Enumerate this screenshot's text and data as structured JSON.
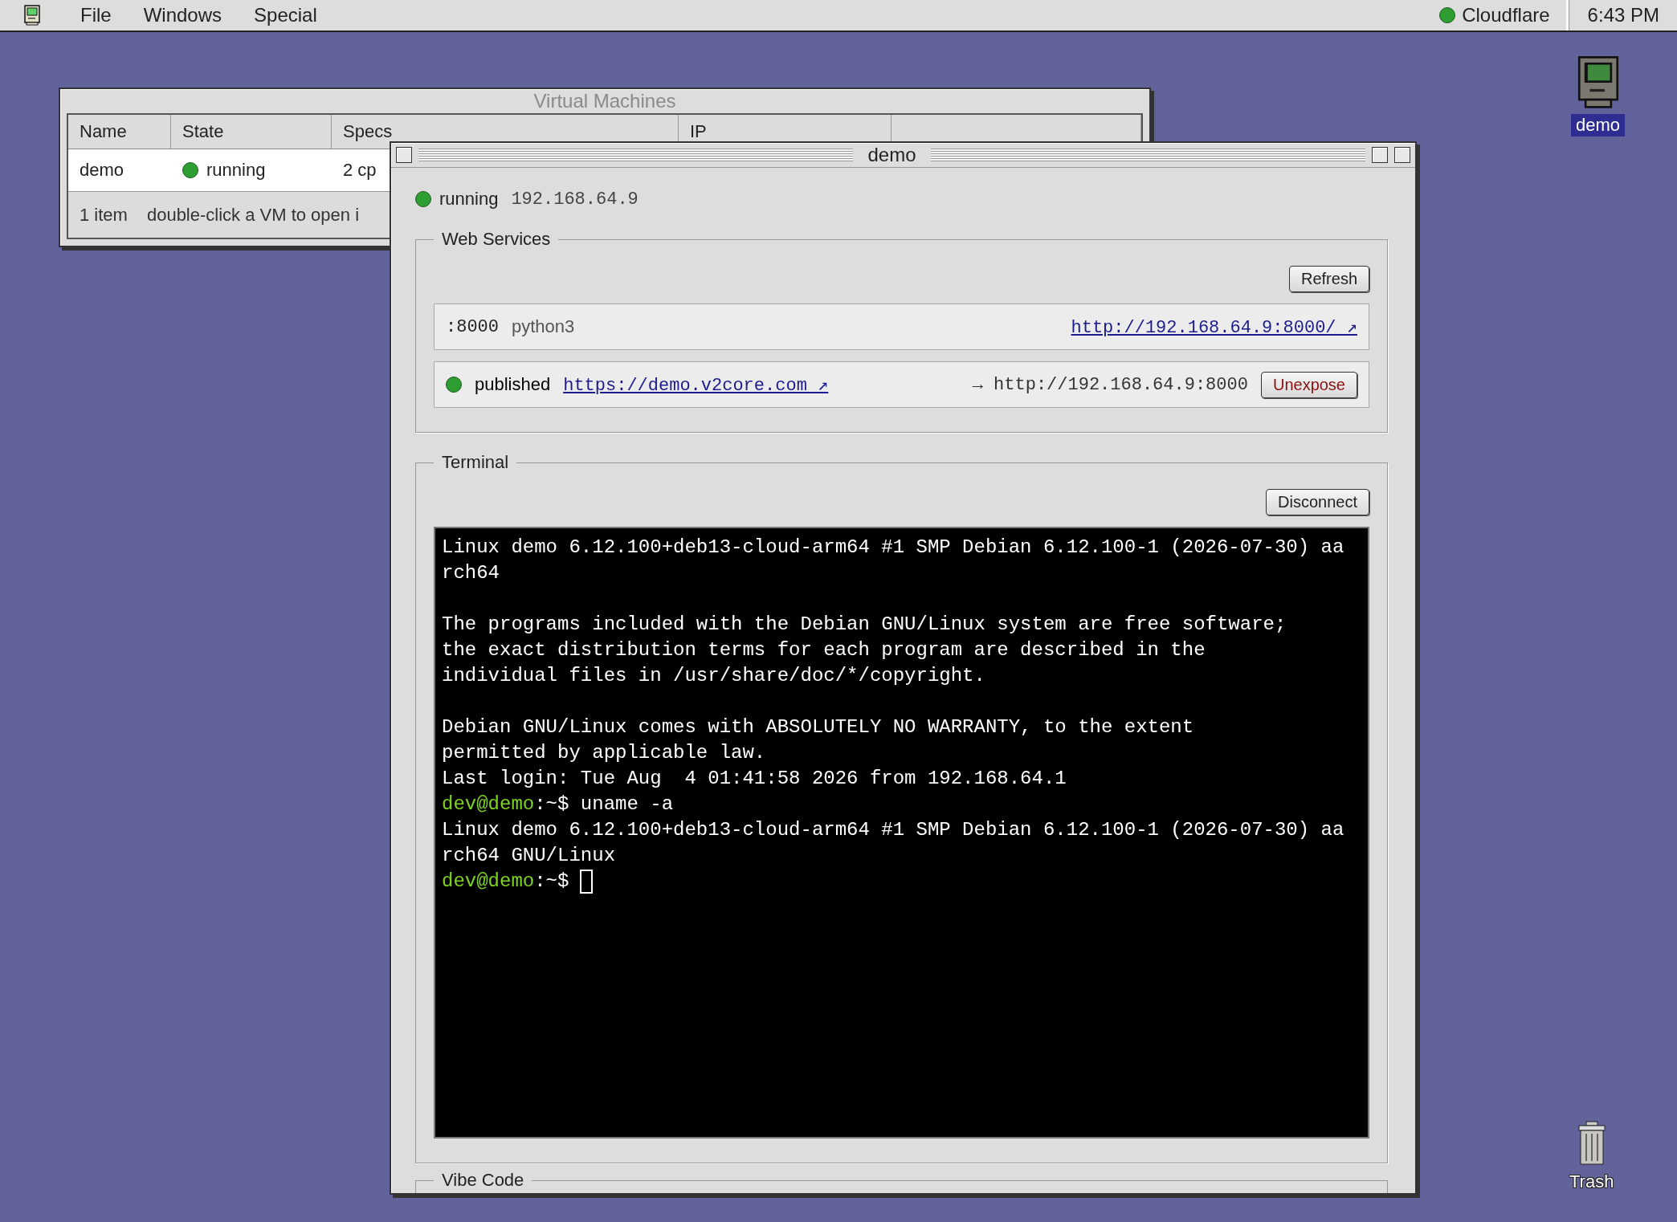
{
  "menu_bar": {
    "items": [
      "File",
      "Windows",
      "Special"
    ],
    "status": {
      "label": "Cloudflare",
      "color": "#2f9e32"
    },
    "clock": "6:43 PM"
  },
  "vm_window": {
    "title": "Virtual Machines",
    "active": false,
    "columns": [
      "Name",
      "State",
      "Specs",
      "IP"
    ],
    "rows": [
      {
        "name": "demo",
        "state": "running",
        "color": "#2f9e32",
        "specs": "2 cp"
      }
    ],
    "status_bar": {
      "count": "1 item",
      "hint": "double-click a VM to open i"
    }
  },
  "demo_window": {
    "title": "demo",
    "active": true,
    "status": {
      "label": "running",
      "color": "#2f9e32",
      "ip": "192.168.64.9"
    },
    "web_services": {
      "legend": "Web Services",
      "refresh": "Refresh",
      "services": [
        {
          "kind": "local",
          "port": ":8000",
          "process": "python3",
          "url": "http://192.168.64.9:8000/ ↗"
        },
        {
          "kind": "published",
          "label": "published",
          "color": "#2f9e32",
          "url": "https://demo.v2core.com ↗",
          "target": "→ http://192.168.64.9:8000",
          "action": "Unexpose"
        }
      ]
    },
    "terminal": {
      "legend": "Terminal",
      "disconnect": "Disconnect",
      "lines": [
        {
          "kind": "text",
          "text": "Linux demo 6.12.100+deb13-cloud-arm64 #1 SMP Debian 6.12.100-1 (2026-07-30) aa"
        },
        {
          "kind": "text",
          "text": "rch64"
        },
        {
          "kind": "blank"
        },
        {
          "kind": "text",
          "text": "The programs included with the Debian GNU/Linux system are free software;"
        },
        {
          "kind": "text",
          "text": "the exact distribution terms for each program are described in the"
        },
        {
          "kind": "text",
          "text": "individual files in /usr/share/doc/*/copyright."
        },
        {
          "kind": "blank"
        },
        {
          "kind": "text",
          "text": "Debian GNU/Linux comes with ABSOLUTELY NO WARRANTY, to the extent"
        },
        {
          "kind": "text",
          "text": "permitted by applicable law."
        },
        {
          "kind": "text",
          "text": "Last login: Tue Aug  4 01:41:58 2026 from 192.168.64.1"
        },
        {
          "kind": "prompt",
          "user": "dev@demo",
          "path": ":~$",
          "command": "uname -a",
          "cursor": false
        },
        {
          "kind": "text",
          "text": "Linux demo 6.12.100+deb13-cloud-arm64 #1 SMP Debian 6.12.100-1 (2026-07-30) aa"
        },
        {
          "kind": "text",
          "text": "rch64 GNU/Linux"
        },
        {
          "kind": "prompt",
          "user": "dev@demo",
          "path": ":~$",
          "cursor": true
        }
      ]
    },
    "vibe_code": {
      "legend": "Vibe Code"
    }
  },
  "desktop_icons": [
    {
      "kind": "computer",
      "label": "demo",
      "selected": true
    },
    {
      "kind": "trash",
      "label": "Trash",
      "selected": false
    }
  ]
}
